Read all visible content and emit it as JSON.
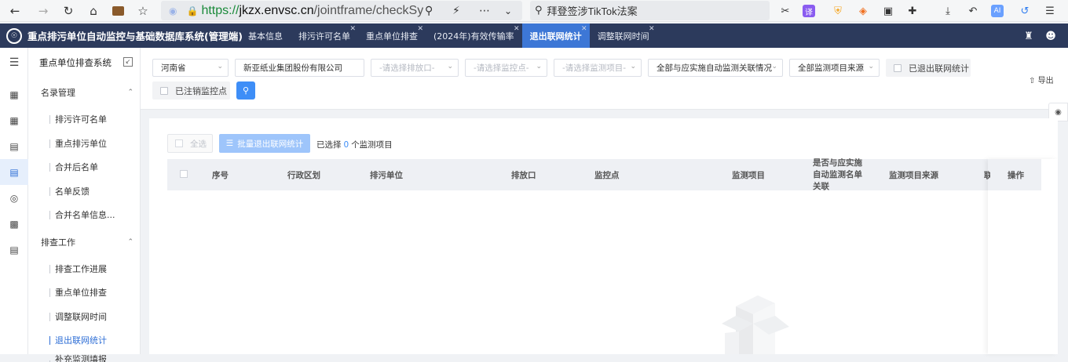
{
  "browser": {
    "url_scheme": "https://",
    "url_host": "jkzx.envsc.cn",
    "url_path": "/jointframe/checkSy",
    "search_query": "拜登签涉TikTok法案"
  },
  "app": {
    "title": "重点排污单位自动监控与基础数据库系统(管理端)",
    "tabs": [
      {
        "label": "基本信息",
        "closable": false
      },
      {
        "label": "排污许可名单",
        "closable": true
      },
      {
        "label": "重点单位排查",
        "closable": true
      },
      {
        "label": "(2024年)有效传输率",
        "closable": true
      },
      {
        "label": "退出联网统计",
        "closable": true,
        "active": true
      },
      {
        "label": "调整联网时间",
        "closable": true
      }
    ]
  },
  "sidebar": {
    "title": "重点单位排查系统",
    "groups": [
      {
        "label": "名录管理",
        "items": [
          "排污许可名单",
          "重点排污单位",
          "合并后名单",
          "名单反馈",
          "合并名单信息..."
        ]
      },
      {
        "label": "排查工作",
        "items": [
          "排查工作进展",
          "重点单位排查",
          "调整联网时间",
          "退出联网统计",
          "补充监测填报"
        ]
      }
    ],
    "active_item": "退出联网统计"
  },
  "filters": {
    "province": "河南省",
    "company": "新亚纸业集团股份有限公司",
    "outlet_placeholder": "-请选择排放口-",
    "point_placeholder": "-请选择监控点-",
    "item_placeholder": "-请选择监测项目-",
    "relation": "全部与应实施自动监测关联情况",
    "source": "全部监测项目来源",
    "exited_label": "已退出联网统计",
    "cancelled_label": "已注销监控点",
    "export_label": "导出"
  },
  "toolbar": {
    "select_all": "全选",
    "batch_exit": "批量退出联网统计",
    "selected_prefix": "已选择",
    "selected_count": "0",
    "selected_suffix": "个监测项目"
  },
  "table": {
    "headers": [
      "序号",
      "行政区划",
      "排污单位",
      "排放口",
      "监控点",
      "监测项目",
      "是否与应实施自动监测名单关联",
      "监测项目来源",
      "联",
      "操作"
    ]
  },
  "colors": {
    "header_bg": "#2c3a5c",
    "active_tab": "#3d77d6",
    "primary": "#3e8ef7",
    "primary_light": "#9ec5fb"
  }
}
